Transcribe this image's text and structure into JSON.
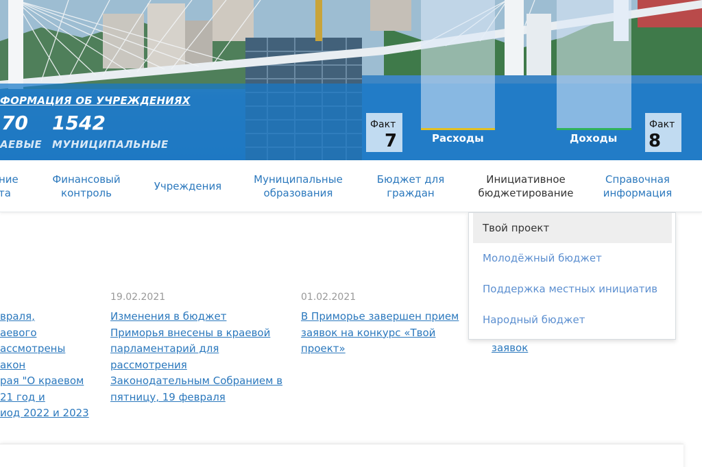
{
  "hero": {
    "info_link": "ФОРМАЦИЯ ОБ УЧРЕЖДЕНИЯХ",
    "stats": [
      {
        "value": "70",
        "label": "АЕВЫЕ"
      },
      {
        "value": "1542",
        "label": "МУНИЦИПАЛЬНЫЕ"
      }
    ],
    "fact_left": {
      "label": "Факт",
      "value": "7"
    },
    "fact_right": {
      "label": "Факт",
      "value": "8"
    },
    "expenses": {
      "label": "Расходы",
      "color": "#e4c020"
    },
    "income": {
      "label": "Доходы",
      "color": "#2fb35a"
    }
  },
  "nav": {
    "items": [
      {
        "label": "ние\nта"
      },
      {
        "label": "Финансовый\nконтроль"
      },
      {
        "label": "Учреждения"
      },
      {
        "label": "Муниципальные\nобразования"
      },
      {
        "label": "Бюджет для\nграждан"
      },
      {
        "label": "Инициативное\nбюджетирование"
      },
      {
        "label": "Справочная\nинформация"
      }
    ]
  },
  "dropdown": {
    "items": [
      {
        "label": "Твой проект"
      },
      {
        "label": "Молодёжный бюджет"
      },
      {
        "label": "Поддержка местных инициатив"
      },
      {
        "label": "Народный бюджет"
      }
    ]
  },
  "news": [
    {
      "date": "",
      "text": "враля,\nаевого\nассмотрены\nакон\nрая \"О краевом\n21 год и\nиод 2022 и 2023"
    },
    {
      "date": "19.02.2021",
      "text": "Изменения в бюджет\nПриморья внесены в краевой\nпарламентарий для\nрассмотрения\nЗаконодательным Собранием в\nпятницу, 19 февраля"
    },
    {
      "date": "01.02.2021",
      "text": "В Приморье завершен прием\nзаявок на конкурс «Твой\nпроект»"
    },
    {
      "date": "",
      "text": "заявок"
    }
  ],
  "colors": {
    "link": "#2b78bd",
    "dropdown_link": "#5c8fd0",
    "banner_blue": "#1778c8"
  }
}
